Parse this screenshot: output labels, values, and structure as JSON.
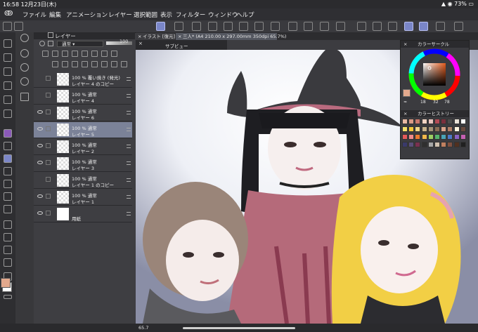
{
  "status": {
    "time": "16:58",
    "date": "12月23日(木)",
    "battery": "73%"
  },
  "menu": [
    "ファイル",
    "編集",
    "アニメーション",
    "レイヤー",
    "選択範囲",
    "表示",
    "フィルター",
    "ウィンドウ",
    "ヘルプ"
  ],
  "layers_panel": {
    "title": "レイヤー",
    "blend_mode": "通常",
    "opacity": "100",
    "layers": [
      {
        "line1": "100 % 覆い焼き (発光)",
        "line2": "レイヤー 4 のコピー",
        "visible": false,
        "selected": false,
        "thumb": "checker"
      },
      {
        "line1": "100 % 通常",
        "line2": "レイヤー 4",
        "visible": false,
        "selected": false,
        "thumb": "checker"
      },
      {
        "line1": "100 % 通常",
        "line2": "レイヤー 6",
        "visible": true,
        "selected": false,
        "thumb": "checker"
      },
      {
        "line1": "100 % 通常",
        "line2": "レイヤー 5",
        "visible": true,
        "selected": true,
        "thumb": "checker"
      },
      {
        "line1": "100 % 通常",
        "line2": "レイヤー 2",
        "visible": true,
        "selected": false,
        "thumb": "checker"
      },
      {
        "line1": "100 % 通常",
        "line2": "レイヤー 3",
        "visible": true,
        "selected": false,
        "thumb": "checker"
      },
      {
        "line1": "100 % 通常",
        "line2": "レイヤー 1 のコピー",
        "visible": false,
        "selected": false,
        "thumb": "checker"
      },
      {
        "line1": "100 % 通常",
        "line2": "レイヤー 1",
        "visible": true,
        "selected": false,
        "thumb": "checker"
      },
      {
        "line1": "",
        "line2": "用紙",
        "visible": true,
        "selected": false,
        "thumb": "white"
      }
    ]
  },
  "tabs": [
    {
      "label": "イラスト [復元]"
    },
    {
      "label": "三人* (A4 210.00 x 297.00mm 350dpi 65.7%)"
    }
  ],
  "subview": {
    "title": "サブビュー"
  },
  "color_circle": {
    "title": "カラーサークル",
    "h": "18",
    "s": "32",
    "v": "78"
  },
  "color_history": {
    "title": "カラーヒストリー",
    "swatches": [
      "#e8b9a4",
      "#d99a86",
      "#c9776b",
      "#f2d4c4",
      "#eac6c0",
      "#b34a55",
      "#7a2f3d",
      "#4c4c4c",
      "#e9e2d8",
      "#ffffff",
      "#f4e06b",
      "#f2c73a",
      "#f1d88a",
      "#c6b28c",
      "#a29177",
      "#8a6c55",
      "#dba48b",
      "#b07d66",
      "#fff5e0",
      "#6a4b3f",
      "#e35a5a",
      "#f08a8a",
      "#e97a30",
      "#f2b84b",
      "#9ccf63",
      "#56b36d",
      "#49a3b7",
      "#4d78c7",
      "#8a62c4",
      "#c560b2",
      "#3a3a6a",
      "#5a4f7a",
      "#7a3050",
      "#2f2f2f",
      "#a6a6a6",
      "#d0c0b0",
      "#c08060",
      "#805040",
      "#503020",
      "#202020"
    ]
  },
  "colors": {
    "main": "#e3a98d",
    "sub": "#ffffff"
  },
  "zoom": "65.7"
}
